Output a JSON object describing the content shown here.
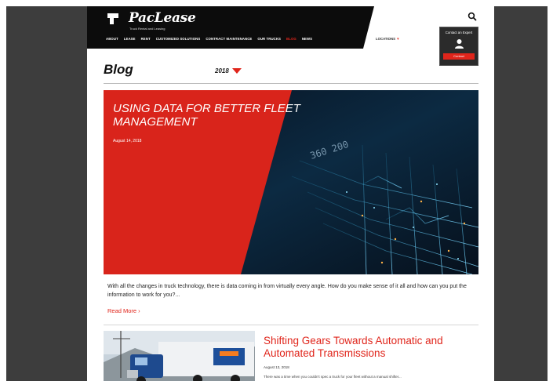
{
  "brand": {
    "name": "PacLease",
    "tagline": "Truck Rental and Leasing"
  },
  "nav": {
    "items": [
      {
        "label": "ABOUT"
      },
      {
        "label": "LEASE"
      },
      {
        "label": "RENT"
      },
      {
        "label": "CUSTOMIZED SOLUTIONS"
      },
      {
        "label": "CONTRACT MAINTENANCE"
      },
      {
        "label": "OUR TRUCKS"
      },
      {
        "label": "BLOG"
      },
      {
        "label": "NEWS"
      }
    ],
    "active": "BLOG",
    "locations": "LOCATIONS"
  },
  "contact": {
    "label": "Contact an Expert",
    "button": "Contact"
  },
  "page_title": "Blog",
  "year_filter": "2018",
  "featured": {
    "title": "USING DATA FOR BETTER FLEET MANAGEMENT",
    "date": "August 14, 2018",
    "excerpt": "With all the changes in truck technology, there is data coming in from virtually every angle. How do you make sense of it all and how can you put the information to work for you?...",
    "read_more": "Read More ›",
    "overlay_numbers": "360 200"
  },
  "second_post": {
    "title": "Shifting Gears Towards Automatic and Automated Transmissions",
    "date": "August 13, 2018",
    "excerpt": "There was a time when you couldn't spec a truck for your fleet without a manual shifter..."
  },
  "colors": {
    "accent": "#e0251b",
    "header": "#0c0c0c",
    "sidebar": "#3d3d3d"
  }
}
